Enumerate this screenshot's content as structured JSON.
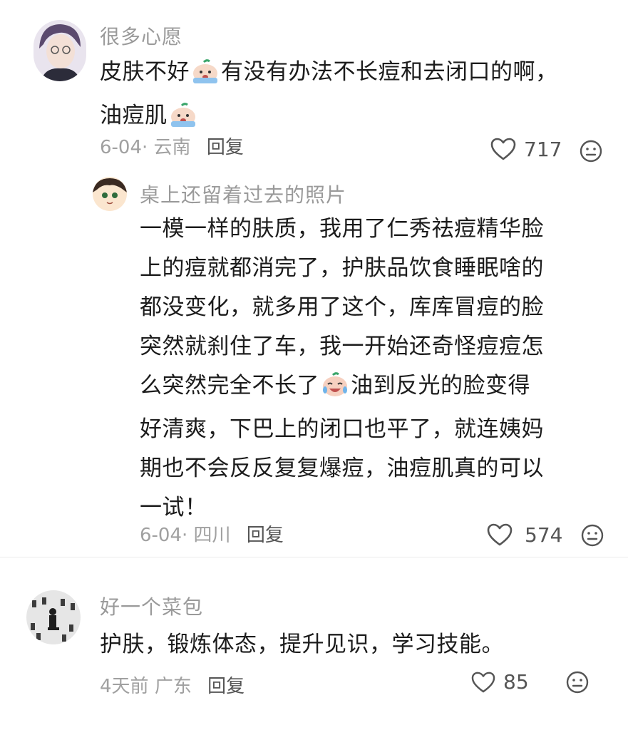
{
  "comments": [
    {
      "user": "很多心愿",
      "lines": [
        "皮肤不好",
        "有没有办法不长痘和去闭口的啊，",
        "油痘肌"
      ],
      "date": "6-04·",
      "location": "云南",
      "reply_label": "回复",
      "likes": "717"
    },
    {
      "user": "桌上还留着过去的照片",
      "lines": [
        "一模一样的肤质，我用了仁秀祛痘精华脸",
        "上的痘就都消完了，护肤品饮食睡眠啥的",
        "都没变化，就多用了这个，库库冒痘的脸",
        "突然就刹住了车，我一开始还奇怪痘痘怎",
        "么突然完全不长了",
        "油到反光的脸变得",
        "好清爽，下巴上的闭口也平了，就连姨妈",
        "期也不会反反复复爆痘，油痘肌真的可以",
        "一试！"
      ],
      "date": "6-04·",
      "location": "四川",
      "reply_label": "回复",
      "likes": "574"
    },
    {
      "user": "好一个菜包",
      "lines": [
        "护肤，锻炼体态，提升见识，学习技能。"
      ],
      "date": "4天前",
      "location": "广东",
      "reply_label": "回复",
      "likes": "85"
    }
  ],
  "icons": {
    "like": "heart-outline-icon",
    "react": "neutral-face-icon",
    "emoji_cry": "crying-face-emoji-icon",
    "emoji_laugh_cry": "tears-of-joy-emoji-icon"
  },
  "colors": {
    "username": "#9a9a9a",
    "text": "#1c1c1c",
    "meta": "#a0a0a0",
    "icon": "#555555"
  }
}
